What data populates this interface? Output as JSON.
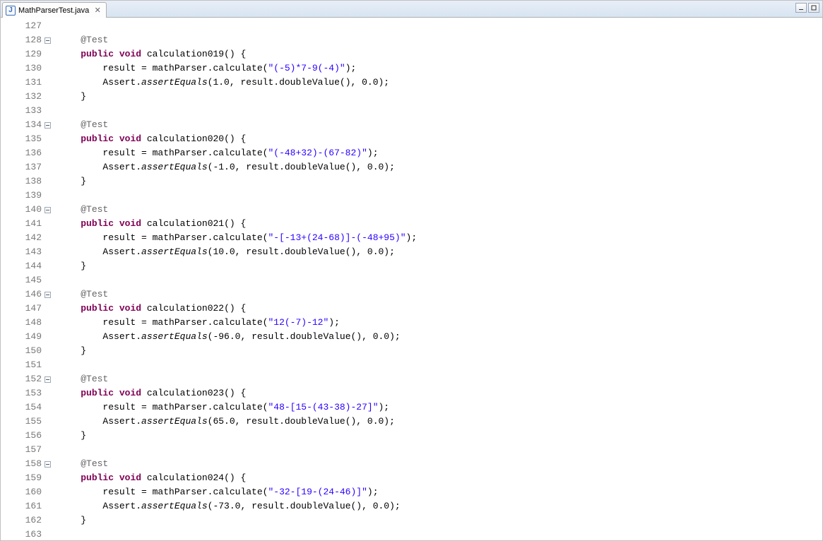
{
  "tab": {
    "filename": "MathParserTest.java",
    "icon_letter": "J"
  },
  "gutter": {
    "start": 127,
    "end": 163,
    "fold_lines": [
      128,
      134,
      140,
      146,
      152,
      158
    ]
  },
  "code": {
    "indent1": "    ",
    "indent2": "        ",
    "obj_result": "result",
    "obj_mathParser": "mathParser",
    "obj_Assert": "Assert",
    "m_calculate": "calculate",
    "m_assertEquals": "assertEquals",
    "m_doubleValue": "doubleValue",
    "kw_public": "public",
    "kw_void": "void",
    "ann_test": "@Test",
    "brace_close": "}",
    "empty": "",
    "tests": [
      {
        "name": "calculation019",
        "expr": "\"(-5)*7-9(-4)\"",
        "expected": "1.0",
        "delta": "0.0"
      },
      {
        "name": "calculation020",
        "expr": "\"(-48+32)-(67-82)\"",
        "expected": "-1.0",
        "delta": "0.0"
      },
      {
        "name": "calculation021",
        "expr": "\"-[-13+(24-68)]-(-48+95)\"",
        "expected": "10.0",
        "delta": "0.0"
      },
      {
        "name": "calculation022",
        "expr": "\"12(-7)-12\"",
        "expected": "-96.0",
        "delta": "0.0"
      },
      {
        "name": "calculation023",
        "expr": "\"48-[15-(43-38)-27]\"",
        "expected": "65.0",
        "delta": "0.0"
      },
      {
        "name": "calculation024",
        "expr": "\"-32-[19-(24-46)]\"",
        "expected": "-73.0",
        "delta": "0.0"
      }
    ]
  }
}
